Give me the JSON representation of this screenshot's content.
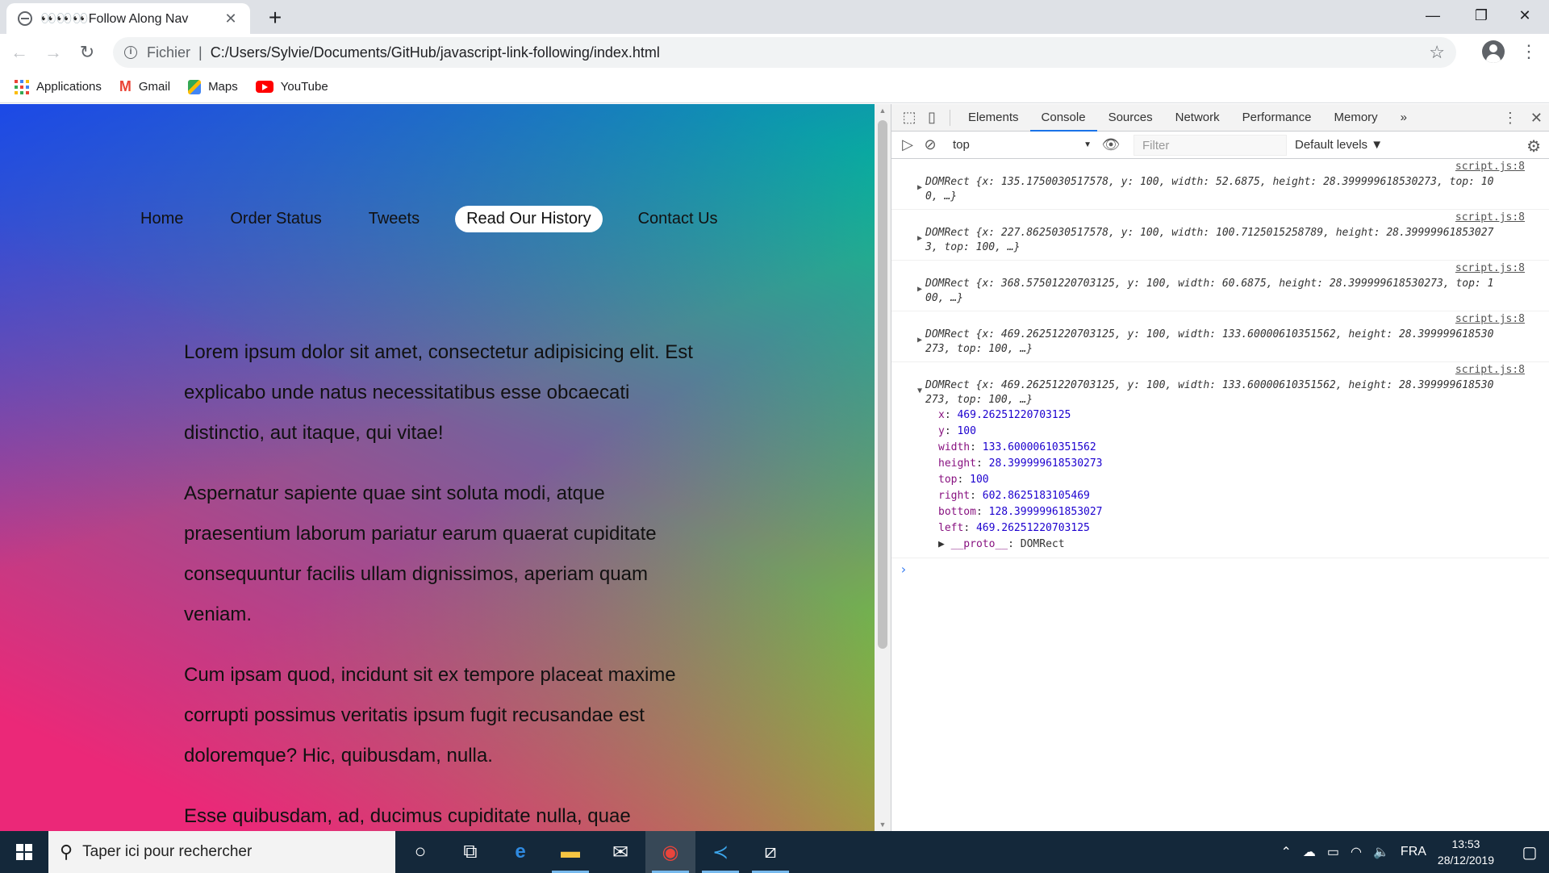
{
  "browser": {
    "tab_title": "👀👀👀Follow Along Nav",
    "tab_close": "✕",
    "new_tab": "+",
    "window_controls": [
      "—",
      "❐",
      "✕"
    ],
    "omnibox": {
      "scheme_label": "Fichier",
      "separator": "|",
      "url": "C:/Users/Sylvie/Documents/GitHub/javascript-link-following/index.html"
    },
    "bookmarks": [
      {
        "label": "Applications",
        "icon": "apps-grid-icon"
      },
      {
        "label": "Gmail",
        "icon": "gmail-icon"
      },
      {
        "label": "Maps",
        "icon": "maps-icon"
      },
      {
        "label": "YouTube",
        "icon": "youtube-icon"
      }
    ]
  },
  "page": {
    "nav": [
      {
        "label": "Home",
        "active": false
      },
      {
        "label": "Order Status",
        "active": false
      },
      {
        "label": "Tweets",
        "active": false
      },
      {
        "label": "Read Our History",
        "active": true
      },
      {
        "label": "Contact Us",
        "active": false
      }
    ],
    "paragraphs": [
      "Lorem ipsum dolor sit amet, consectetur adipisicing elit. Est explicabo unde natus necessitatibus esse obcaecati distinctio, aut itaque, qui vitae!",
      "Aspernatur sapiente quae sint soluta modi, atque praesentium laborum pariatur earum quaerat cupiditate consequuntur facilis ullam dignissimos, aperiam quam veniam.",
      "Cum ipsam quod, incidunt sit ex tempore placeat maxime corrupti possimus veritatis ipsum fugit recusandae est doloremque? Hic, quibusdam, nulla.",
      "Esse quibusdam, ad, ducimus cupiditate nulla, quae"
    ]
  },
  "devtools": {
    "tabs": [
      "Elements",
      "Console",
      "Sources",
      "Network",
      "Performance",
      "Memory"
    ],
    "active_tab": "Console",
    "overflow": "»",
    "context": "top",
    "filter_placeholder": "Filter",
    "levels": "Default levels ▼",
    "messages": [
      {
        "source": "script.js:8",
        "text_a": "DOMRect {x: 135.1750030517578, y: 100, width: 52.6875, height: 28.399999618530273, top: 10",
        "text_b": "0, …}"
      },
      {
        "source": "script.js:8",
        "text_a": "DOMRect {x: 227.8625030517578, y: 100, width: 100.7125015258789, height: 28.39999961853027",
        "text_b": "3, top: 100, …}"
      },
      {
        "source": "script.js:8",
        "text_a": "DOMRect {x: 368.57501220703125, y: 100, width: 60.6875, height: 28.399999618530273, top: 1",
        "text_b": "00, …}"
      },
      {
        "source": "script.js:8",
        "text_a": "DOMRect {x: 469.26251220703125, y: 100, width: 133.60000610351562, height: 28.399999618530",
        "text_b": "273, top: 100, …}"
      }
    ],
    "expanded_message": {
      "source": "script.js:8",
      "text_a": "DOMRect {x: 469.26251220703125, y: 100, width: 133.60000610351562, height: 28.399999618530",
      "text_b": "273, top: 100, …}",
      "props": [
        {
          "key": "x",
          "value": "469.26251220703125"
        },
        {
          "key": "y",
          "value": "100"
        },
        {
          "key": "width",
          "value": "133.60000610351562"
        },
        {
          "key": "height",
          "value": "28.399999618530273"
        },
        {
          "key": "top",
          "value": "100"
        },
        {
          "key": "right",
          "value": "602.8625183105469"
        },
        {
          "key": "bottom",
          "value": "128.39999961853027"
        },
        {
          "key": "left",
          "value": "469.26251220703125"
        },
        {
          "key": "__proto__",
          "value": "DOMRect"
        }
      ]
    },
    "prompt": "›"
  },
  "taskbar": {
    "search_placeholder": "Taper ici pour rechercher",
    "language": "FRA",
    "time": "13:53",
    "date": "28/12/2019"
  }
}
